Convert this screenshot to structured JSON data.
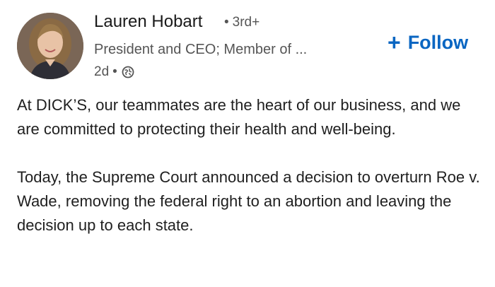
{
  "author": {
    "name": "Lauren Hobart",
    "separator": "•",
    "degree": "3rd+",
    "headline": "President and CEO; Member of ...",
    "posted": "2d",
    "posted_separator": "•",
    "visibility_icon": "globe-icon",
    "avatar_icon": "profile-photo"
  },
  "follow": {
    "icon": "+",
    "label": "Follow",
    "color": "#0a66c2"
  },
  "post": {
    "paragraphs": [
      "At DICK’S, our teammates are the heart of our business, and we are committed to protecting their health and well-being.",
      "Today, the Supreme Court announced a decision to overturn Roe v. Wade, removing the federal right to an abortion and leaving the decision up to each state."
    ]
  }
}
